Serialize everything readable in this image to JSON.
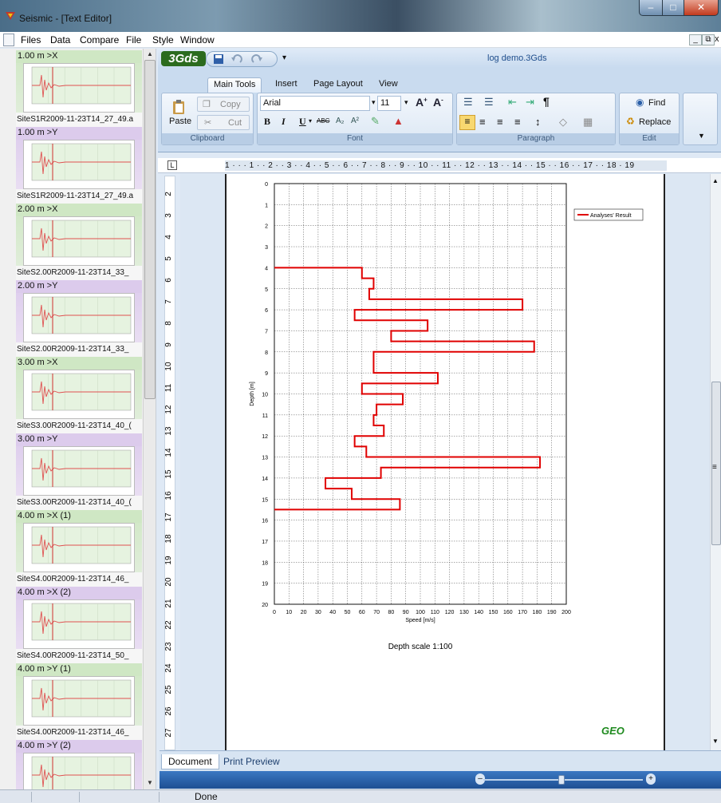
{
  "window": {
    "title": "Seismic - [Text Editor]"
  },
  "menu": [
    "Files",
    "Data",
    "Compare",
    "File",
    "Style",
    "Window"
  ],
  "mdi_controls": {
    "minimize": "_",
    "restore": "ᵈ",
    "close": "x"
  },
  "thumbnails": [
    {
      "header": "1.00 m >X",
      "footer": "SiteS1R2009-11-23T14_27_49.a",
      "color": "g"
    },
    {
      "header": "1.00 m >Y",
      "footer": "SiteS1R2009-11-23T14_27_49.a",
      "color": "p"
    },
    {
      "header": "2.00 m >X",
      "footer": "SiteS2.00R2009-11-23T14_33_",
      "color": "g"
    },
    {
      "header": "2.00 m >Y",
      "footer": "SiteS2.00R2009-11-23T14_33_",
      "color": "p"
    },
    {
      "header": "3.00 m >X",
      "footer": "SiteS3.00R2009-11-23T14_40_(",
      "color": "g"
    },
    {
      "header": "3.00 m >Y",
      "footer": "SiteS3.00R2009-11-23T14_40_(",
      "color": "p"
    },
    {
      "header": "4.00 m >X (1)",
      "footer": "SiteS4.00R2009-11-23T14_46_",
      "color": "g"
    },
    {
      "header": "4.00 m >X (2)",
      "footer": "SiteS4.00R2009-11-23T14_50_",
      "color": "p"
    },
    {
      "header": "4.00 m >Y (1)",
      "footer": "SiteS4.00R2009-11-23T14_46_",
      "color": "g"
    },
    {
      "header": "4.00 m >Y (2)",
      "footer": "",
      "color": "p"
    }
  ],
  "ribbon": {
    "app_logo": "3Gds",
    "document_title": "log demo.3Gds",
    "tabs": [
      "Main Tools",
      "Insert",
      "Page Layout",
      "View"
    ],
    "active_tab": "Main Tools",
    "clipboard": {
      "label": "Clipboard",
      "paste": "Paste",
      "copy": "Copy",
      "cut": "Cut"
    },
    "font": {
      "label": "Font",
      "family": "Arial",
      "size": "11",
      "bold": "B",
      "italic": "I",
      "underline": "U",
      "strike": "ABC"
    },
    "paragraph": {
      "label": "Paragraph"
    },
    "edit": {
      "label": "Edit",
      "find": "Find",
      "replace": "Replace"
    }
  },
  "ruler": {
    "text": "1 · · · 1 · · 2 · · 3 · · 4 · · 5 · · 6 · · 7 · · 8 · · 9 · · 10 · · 11 · · 12 · · 13 · · 14 · · 15 · · 16 · · 17 · · 18 · 19"
  },
  "vertical_ruler_numbers": [
    "2",
    "3",
    "4",
    "5",
    "6",
    "7",
    "8",
    "9",
    "10",
    "11",
    "12",
    "13",
    "14",
    "15",
    "16",
    "17",
    "18",
    "19",
    "20",
    "21",
    "22",
    "23",
    "24",
    "25",
    "26",
    "27"
  ],
  "document": {
    "line_numbers": [
      "17",
      "18",
      "19",
      "20",
      "21",
      "22"
    ],
    "cursor_marker": "▶",
    "depth_scale": "Depth scale 1:100",
    "logo": "GEO"
  },
  "chart_data": {
    "type": "line",
    "xlabel": "Speed [m/s]",
    "ylabel": "Depth [m]",
    "xlim": [
      0,
      200
    ],
    "ylim": [
      0,
      20
    ],
    "y_inverted": true,
    "x_ticks": [
      0,
      10,
      20,
      30,
      40,
      50,
      60,
      70,
      80,
      90,
      100,
      110,
      120,
      130,
      140,
      150,
      160,
      170,
      180,
      190,
      200
    ],
    "y_ticks": [
      0,
      1,
      2,
      3,
      4,
      5,
      6,
      7,
      8,
      9,
      10,
      11,
      12,
      13,
      14,
      15,
      16,
      17,
      18,
      19,
      20
    ],
    "grid": true,
    "legend": "top-right",
    "series": [
      {
        "name": "Analyses' Result",
        "color": "#e00000",
        "layers": [
          {
            "from": 4.0,
            "to": 4.5,
            "speed": 60
          },
          {
            "from": 4.5,
            "to": 5.0,
            "speed": 68
          },
          {
            "from": 5.0,
            "to": 5.5,
            "speed": 65
          },
          {
            "from": 5.5,
            "to": 6.0,
            "speed": 170
          },
          {
            "from": 6.0,
            "to": 6.5,
            "speed": 55
          },
          {
            "from": 6.5,
            "to": 7.0,
            "speed": 105
          },
          {
            "from": 7.0,
            "to": 7.5,
            "speed": 80
          },
          {
            "from": 7.5,
            "to": 8.0,
            "speed": 178
          },
          {
            "from": 8.0,
            "to": 8.5,
            "speed": 68
          },
          {
            "from": 8.5,
            "to": 9.0,
            "speed": 68
          },
          {
            "from": 9.0,
            "to": 9.5,
            "speed": 112
          },
          {
            "from": 9.5,
            "to": 10.0,
            "speed": 60
          },
          {
            "from": 10.0,
            "to": 10.5,
            "speed": 88
          },
          {
            "from": 10.5,
            "to": 11.0,
            "speed": 70
          },
          {
            "from": 11.0,
            "to": 11.5,
            "speed": 68
          },
          {
            "from": 11.5,
            "to": 12.0,
            "speed": 75
          },
          {
            "from": 12.0,
            "to": 12.5,
            "speed": 55
          },
          {
            "from": 12.5,
            "to": 13.0,
            "speed": 63
          },
          {
            "from": 13.0,
            "to": 13.5,
            "speed": 182
          },
          {
            "from": 13.5,
            "to": 14.0,
            "speed": 73
          },
          {
            "from": 14.0,
            "to": 14.5,
            "speed": 35
          },
          {
            "from": 14.5,
            "to": 15.0,
            "speed": 53
          },
          {
            "from": 15.0,
            "to": 15.5,
            "speed": 86
          }
        ]
      }
    ]
  },
  "tabs_bottom": {
    "document": "Document",
    "print_preview": "Print Preview"
  },
  "status": {
    "text": "Done"
  }
}
